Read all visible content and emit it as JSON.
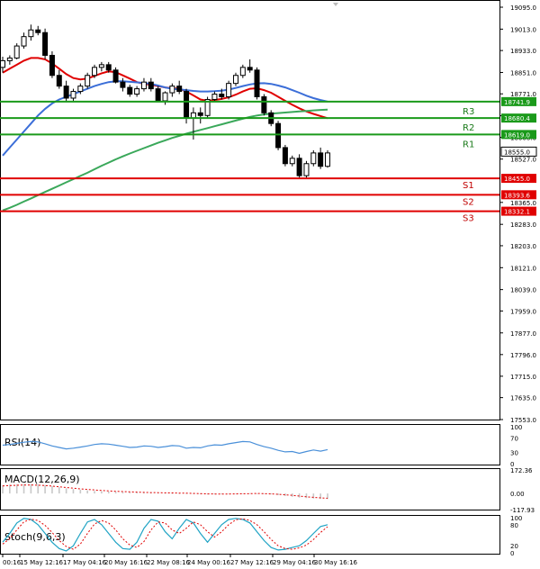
{
  "chart_data": [
    {
      "type": "candlestick",
      "price_ticks": [
        "19095.0",
        "19013.0",
        "18933.0",
        "18851.0",
        "18771.0",
        "18689.0",
        "18608.0",
        "18527.0",
        "18365.0",
        "18283.0",
        "18203.0",
        "18121.0",
        "18039.0",
        "17959.0",
        "17877.0",
        "17796.0",
        "17715.0",
        "17635.0",
        "17553.0"
      ],
      "ylim": [
        17553,
        19095
      ],
      "levels": [
        {
          "name": "R3",
          "value": 18741.9,
          "label": "18741.9",
          "color": "#1a9a1a"
        },
        {
          "name": "R2",
          "value": 18680.4,
          "label": "18680.4",
          "color": "#1a9a1a"
        },
        {
          "name": "R1",
          "value": 18619.0,
          "label": "18619.0",
          "color": "#1a9a1a"
        },
        {
          "name": "S1",
          "value": 18455.0,
          "label": "18455.0",
          "color": "#e00000"
        },
        {
          "name": "S2",
          "value": 18393.6,
          "label": "18393.6",
          "color": "#e00000"
        },
        {
          "name": "S3",
          "value": 18332.1,
          "label": "18332.1",
          "color": "#e00000"
        }
      ],
      "current_price": {
        "value": 18555.0,
        "label": "18555.0"
      },
      "ohlc": [
        [
          18870,
          18910,
          18850,
          18895
        ],
        [
          18895,
          18915,
          18880,
          18905
        ],
        [
          18905,
          18960,
          18900,
          18950
        ],
        [
          18950,
          19000,
          18940,
          18985
        ],
        [
          18985,
          19030,
          18970,
          19010
        ],
        [
          19010,
          19025,
          18990,
          19000
        ],
        [
          19000,
          19015,
          18900,
          18915
        ],
        [
          18915,
          18930,
          18830,
          18840
        ],
        [
          18840,
          18860,
          18790,
          18800
        ],
        [
          18800,
          18820,
          18740,
          18755
        ],
        [
          18755,
          18790,
          18745,
          18780
        ],
        [
          18780,
          18810,
          18770,
          18800
        ],
        [
          18800,
          18850,
          18790,
          18840
        ],
        [
          18840,
          18880,
          18830,
          18870
        ],
        [
          18870,
          18890,
          18855,
          18880
        ],
        [
          18880,
          18890,
          18850,
          18860
        ],
        [
          18860,
          18870,
          18810,
          18815
        ],
        [
          18815,
          18830,
          18780,
          18795
        ],
        [
          18795,
          18805,
          18760,
          18770
        ],
        [
          18770,
          18800,
          18760,
          18790
        ],
        [
          18790,
          18830,
          18780,
          18815
        ],
        [
          18815,
          18830,
          18780,
          18790
        ],
        [
          18790,
          18800,
          18740,
          18745
        ],
        [
          18745,
          18780,
          18730,
          18775
        ],
        [
          18775,
          18810,
          18760,
          18800
        ],
        [
          18800,
          18820,
          18770,
          18780
        ],
        [
          18780,
          18790,
          18660,
          18680
        ],
        [
          18680,
          18720,
          18600,
          18700
        ],
        [
          18700,
          18720,
          18660,
          18690
        ],
        [
          18690,
          18760,
          18680,
          18750
        ],
        [
          18750,
          18780,
          18740,
          18770
        ],
        [
          18770,
          18790,
          18750,
          18760
        ],
        [
          18760,
          18820,
          18750,
          18810
        ],
        [
          18810,
          18850,
          18800,
          18840
        ],
        [
          18840,
          18880,
          18830,
          18870
        ],
        [
          18870,
          18900,
          18850,
          18860
        ],
        [
          18860,
          18870,
          18750,
          18760
        ],
        [
          18760,
          18770,
          18690,
          18700
        ],
        [
          18700,
          18710,
          18650,
          18660
        ],
        [
          18660,
          18670,
          18560,
          18570
        ],
        [
          18570,
          18580,
          18500,
          18510
        ],
        [
          18510,
          18540,
          18500,
          18530
        ],
        [
          18530,
          18545,
          18455,
          18465
        ],
        [
          18465,
          18520,
          18455,
          18510
        ],
        [
          18510,
          18560,
          18500,
          18550
        ],
        [
          18550,
          18570,
          18490,
          18500
        ],
        [
          18500,
          18560,
          18495,
          18550
        ]
      ],
      "moving_averages": [
        {
          "name": "MA fast",
          "color": "#e00000",
          "values": [
            18850,
            18865,
            18880,
            18895,
            18905,
            18905,
            18900,
            18885,
            18865,
            18845,
            18830,
            18825,
            18828,
            18838,
            18848,
            18855,
            18852,
            18840,
            18828,
            18815,
            18808,
            18805,
            18800,
            18795,
            18792,
            18790,
            18780,
            18765,
            18750,
            18745,
            18748,
            18752,
            18758,
            18768,
            18780,
            18790,
            18792,
            18785,
            18775,
            18760,
            18745,
            18730,
            18717,
            18705,
            18696,
            18688,
            18680
          ]
        },
        {
          "name": "MA medium",
          "color": "#3b6ed8",
          "values": [
            18540,
            18570,
            18600,
            18630,
            18660,
            18690,
            18715,
            18735,
            18750,
            18760,
            18770,
            18780,
            18790,
            18800,
            18808,
            18815,
            18818,
            18818,
            18816,
            18814,
            18812,
            18808,
            18802,
            18795,
            18790,
            18788,
            18785,
            18782,
            18780,
            18780,
            18781,
            18783,
            18787,
            18793,
            18800,
            18806,
            18810,
            18811,
            18808,
            18802,
            18795,
            18785,
            18775,
            18764,
            18755,
            18748,
            18742
          ]
        },
        {
          "name": "MA slow",
          "color": "#3aa85a",
          "values": [
            18335,
            18345,
            18356,
            18368,
            18380,
            18392,
            18404,
            18416,
            18428,
            18440,
            18452,
            18464,
            18476,
            18489,
            18502,
            18514,
            18526,
            18537,
            18548,
            18558,
            18568,
            18578,
            18588,
            18597,
            18606,
            18614,
            18622,
            18629,
            18636,
            18643,
            18650,
            18657,
            18664,
            18671,
            18678,
            18685,
            18690,
            18694,
            18697,
            18699,
            18701,
            18703,
            18705,
            18707,
            18709,
            18711,
            18712
          ]
        }
      ],
      "level_names": [
        "R3",
        "R2",
        "R1",
        "S1",
        "S2",
        "S3"
      ]
    },
    {
      "type": "line",
      "title": "RSI(14)",
      "ticks": [
        "100",
        "70",
        "30",
        "0"
      ],
      "ylim": [
        0,
        100
      ],
      "values": [
        50,
        52,
        55,
        58,
        60,
        59,
        54,
        48,
        44,
        40,
        42,
        45,
        48,
        52,
        54,
        53,
        50,
        47,
        44,
        45,
        48,
        47,
        44,
        46,
        49,
        48,
        42,
        44,
        43,
        48,
        51,
        50,
        54,
        57,
        60,
        59,
        52,
        46,
        42,
        36,
        32,
        33,
        28,
        33,
        37,
        34,
        38
      ]
    },
    {
      "type": "bar",
      "title": "MACD(12,26,9)",
      "ticks": [
        "172.36",
        "0.00",
        "-117.93"
      ],
      "ylim": [
        -117.93,
        172.36
      ],
      "histogram": [
        60,
        65,
        68,
        70,
        70,
        68,
        62,
        54,
        46,
        38,
        32,
        27,
        22,
        18,
        16,
        14,
        12,
        10,
        8,
        7,
        6,
        5,
        3,
        2,
        1,
        0,
        -2,
        -4,
        -6,
        -7,
        -6,
        -5,
        -3,
        -1,
        0,
        2,
        1,
        -2,
        -6,
        -12,
        -18,
        -24,
        -30,
        -34,
        -37,
        -39,
        -40
      ],
      "signal": [
        55,
        58,
        60,
        62,
        62,
        61,
        58,
        54,
        49,
        44,
        39,
        34,
        30,
        26,
        22,
        19,
        16,
        14,
        12,
        10,
        8,
        7,
        6,
        5,
        4,
        3,
        2,
        1,
        -1,
        -3,
        -4,
        -4,
        -4,
        -3,
        -2,
        -1,
        0,
        -1,
        -3,
        -6,
        -10,
        -14,
        -19,
        -24,
        -28,
        -32,
        -35
      ]
    },
    {
      "type": "line",
      "title": "Stoch(9,6,3)",
      "ticks": [
        "100",
        "80",
        "20",
        "0"
      ],
      "ylim": [
        0,
        100
      ],
      "main": [
        30,
        55,
        85,
        98,
        95,
        80,
        55,
        30,
        12,
        5,
        20,
        55,
        88,
        95,
        80,
        55,
        30,
        12,
        10,
        30,
        70,
        95,
        90,
        60,
        40,
        70,
        95,
        85,
        55,
        30,
        55,
        80,
        95,
        98,
        95,
        85,
        60,
        35,
        15,
        8,
        10,
        15,
        20,
        35,
        55,
        75,
        80
      ],
      "signal": [
        25,
        40,
        65,
        88,
        96,
        92,
        78,
        58,
        35,
        18,
        10,
        25,
        55,
        82,
        92,
        85,
        65,
        40,
        22,
        15,
        32,
        65,
        88,
        85,
        65,
        55,
        70,
        88,
        80,
        60,
        45,
        60,
        80,
        94,
        97,
        92,
        80,
        60,
        38,
        20,
        12,
        10,
        14,
        22,
        38,
        58,
        74
      ]
    }
  ],
  "x_labels": [
    "00:16",
    "15 May 12:16",
    "17 May 04:16",
    "20 May 16:16",
    "22 May 08:16",
    "24 May 00:16",
    "27 May 12:16",
    "29 May 04:16",
    "30 May 16:16"
  ]
}
